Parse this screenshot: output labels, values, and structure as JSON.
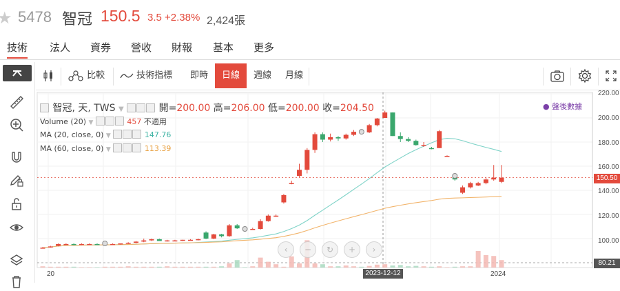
{
  "header": {
    "code": "5478",
    "name": "智冠",
    "price": "150.5",
    "change": "3.5 +2.38%",
    "volume": "2,424張"
  },
  "tabs": [
    "技術",
    "法人",
    "資券",
    "營收",
    "財報",
    "基本",
    "更多"
  ],
  "toolbar": {
    "compare": "比較",
    "indicators": "技術指標",
    "intraday": "即時",
    "daily": "日線",
    "weekly": "週線",
    "monthly": "月線"
  },
  "legend": {
    "main": "智冠, 天, TWS",
    "open_label": "開=",
    "open": "200.00",
    "high_label": "高=",
    "high": "206.00",
    "low_label": "低=",
    "low": "200.00",
    "close_label": "收=",
    "close": "204.50",
    "volume_name": "Volume (20)",
    "volume_val": "457",
    "volume_na": "不適用",
    "ma20_name": "MA (20, close, 0)",
    "ma20_val": "147.76",
    "ma60_name": "MA (60, close, 0)",
    "ma60_val": "113.39"
  },
  "after_hours": "盤後數據",
  "y_ticks": [
    "220.00",
    "200.00",
    "180.00",
    "160.00",
    "140.00",
    "120.00",
    "100.00"
  ],
  "price_tag": "150.50",
  "volume_tag": "80.21",
  "x_ticks": {
    "left": "20",
    "date": "2023-12-12",
    "year": "2024"
  },
  "colors": {
    "up": "#e34a3c",
    "down": "#3aa76d",
    "ma20": "#7fd3c8",
    "ma60": "#f2b46b",
    "accent": "#e34a3c"
  },
  "chart_data": {
    "type": "candlestick",
    "ylim": [
      80,
      220
    ],
    "candles": [
      [
        92.5,
        93,
        92,
        92.5
      ],
      [
        93,
        94,
        92.5,
        93.5
      ],
      [
        94,
        96,
        93.5,
        95.5
      ],
      [
        95.5,
        96,
        95,
        95.5
      ],
      [
        95.5,
        96,
        94.5,
        95
      ],
      [
        95,
        96,
        94.5,
        95.5
      ],
      [
        95.5,
        96,
        95,
        95.5
      ],
      [
        95.5,
        96,
        95,
        95
      ],
      [
        95,
        96,
        94.5,
        95.5
      ],
      [
        95.5,
        96,
        95,
        95.5
      ],
      [
        95.5,
        96,
        95,
        96
      ],
      [
        96,
        97,
        95.5,
        96.5
      ],
      [
        96.5,
        98,
        96,
        97.5
      ],
      [
        97.5,
        100,
        97,
        98.5
      ],
      [
        98.5,
        100,
        98,
        99.5
      ],
      [
        99.5,
        100,
        98,
        98
      ],
      [
        98,
        99,
        97.5,
        98.5
      ],
      [
        98.5,
        99,
        98,
        98.5
      ],
      [
        98.5,
        99,
        98,
        99
      ],
      [
        99,
        99.5,
        98.5,
        99
      ],
      [
        99,
        100,
        98.5,
        99.5
      ],
      [
        105,
        106,
        99.5,
        100
      ],
      [
        100,
        104,
        99.5,
        103.5
      ],
      [
        103.5,
        104,
        101,
        102
      ],
      [
        102,
        112,
        101.5,
        111
      ],
      [
        111,
        112,
        108,
        108.5
      ],
      [
        108.5,
        109,
        107,
        108
      ],
      [
        108,
        109,
        107.5,
        108
      ],
      [
        108,
        116,
        107.5,
        114.5
      ],
      [
        114.5,
        120,
        114,
        119
      ],
      [
        119,
        120,
        118,
        119
      ],
      [
        130,
        137,
        129,
        136
      ],
      [
        146,
        148,
        145,
        146
      ],
      [
        152,
        162,
        151,
        157
      ],
      [
        157,
        175,
        154,
        173.5
      ],
      [
        173.5,
        188,
        171,
        186.5
      ],
      [
        186.5,
        188,
        180,
        182
      ],
      [
        182,
        187,
        180.5,
        184
      ],
      [
        184,
        185,
        181,
        183
      ],
      [
        183,
        187,
        182,
        186
      ],
      [
        186,
        190,
        185,
        188.5
      ],
      [
        188.5,
        190,
        187,
        188
      ],
      [
        188,
        195,
        187.5,
        194
      ],
      [
        194,
        200,
        193,
        199.5
      ],
      [
        200,
        206,
        200,
        204.5
      ],
      [
        204.5,
        204.5,
        185,
        185
      ],
      [
        185,
        188,
        180,
        182.5
      ],
      [
        182.5,
        184,
        180,
        181
      ],
      [
        181,
        182,
        177,
        177.5
      ],
      [
        177.5,
        180,
        176,
        177.5
      ],
      [
        175,
        176,
        174,
        174.5
      ],
      [
        175,
        190,
        175,
        189
      ],
      [
        168.5,
        169,
        168,
        168.5
      ],
      [
        152,
        154,
        148,
        149
      ],
      [
        138,
        144,
        137,
        142.5
      ],
      [
        142.5,
        147,
        141.5,
        146
      ],
      [
        144,
        147,
        143.5,
        146
      ],
      [
        146,
        151,
        145,
        149
      ],
      [
        149,
        161,
        148,
        150.5
      ],
      [
        147,
        161,
        146,
        150.5
      ]
    ]
  }
}
